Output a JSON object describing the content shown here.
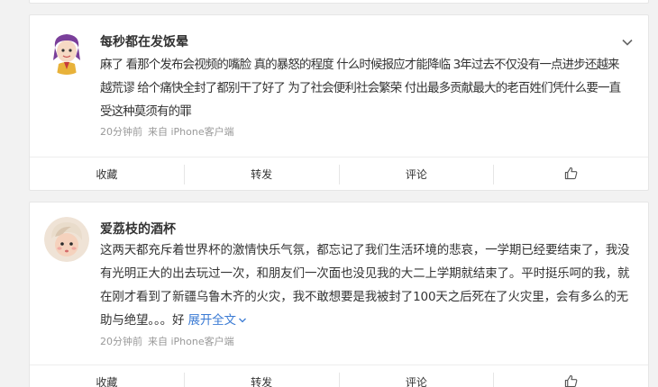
{
  "comments": [
    {
      "username": "每秒都在发饭晕",
      "text": "麻了 看那个发布会视频的嘴脸 真的暴怒的程度 什么时候报应才能降临 3年过去不仅没有一点进步还越来越荒谬 给个痛快全封了都别干了好了 为了社会便利社会繁荣 付出最多贡献最大的老百姓们凭什么要一直受这种莫须有的罪",
      "time": "20分钟前",
      "source": "来自 iPhone客户端",
      "actions": {
        "favorite": "收藏",
        "repost": "转发",
        "comment": "评论"
      }
    },
    {
      "username": "爱荔枝的酒杯",
      "text": "这两天都充斥着世界杯的激情快乐气氛，都忘记了我们生活环境的悲哀，一学期已经要结束了，我没有光明正大的出去玩过一次，和朋友们一次面也没见我的大二上学期就结束了。平时挺乐呵的我，就在刚才看到了新疆乌鲁木齐的火灾，我不敢想要是我被封了100天之后死在了火灾里，会有多么的无助与绝望。。。好",
      "expand": "展开全文",
      "time": "20分钟前",
      "source": "来自 iPhone客户端",
      "actions": {
        "favorite": "收藏",
        "repost": "转发",
        "comment": "评论"
      }
    }
  ],
  "icons": {
    "more": "chevron-down-icon",
    "like": "thumbs-up-icon",
    "expand": "chevron-down-icon"
  },
  "colors": {
    "link": "#3b7bd4",
    "meta": "#999999",
    "background": "#f2f2f2"
  }
}
